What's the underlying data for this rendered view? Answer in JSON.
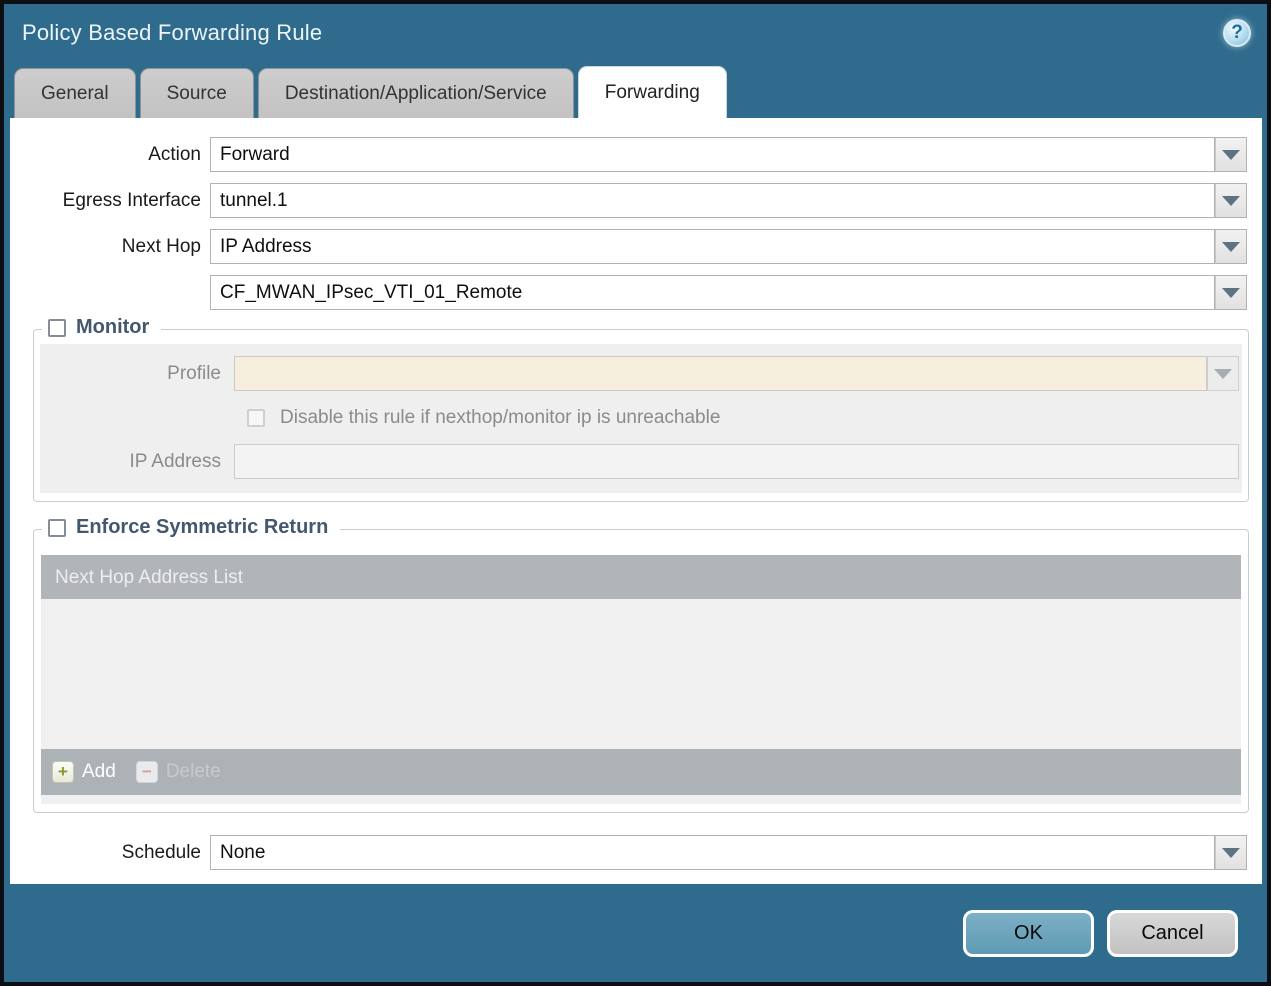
{
  "window": {
    "title": "Policy Based Forwarding Rule"
  },
  "icons": {
    "help": "?",
    "add": "+",
    "delete": "−"
  },
  "tabs": [
    {
      "label": "General",
      "active": false
    },
    {
      "label": "Source",
      "active": false
    },
    {
      "label": "Destination/Application/Service",
      "active": false
    },
    {
      "label": "Forwarding",
      "active": true
    }
  ],
  "form": {
    "action": {
      "label": "Action",
      "value": "Forward"
    },
    "egress_interface": {
      "label": "Egress Interface",
      "value": "tunnel.1"
    },
    "next_hop": {
      "label": "Next Hop",
      "value": "IP Address"
    },
    "next_hop_address": {
      "value": "CF_MWAN_IPsec_VTI_01_Remote"
    },
    "schedule": {
      "label": "Schedule",
      "value": "None"
    }
  },
  "monitor": {
    "legend": "Monitor",
    "checked": false,
    "profile": {
      "label": "Profile",
      "value": ""
    },
    "disable_rule": {
      "label": "Disable this rule if nexthop/monitor ip is unreachable",
      "checked": false
    },
    "ip_address": {
      "label": "IP Address",
      "value": ""
    }
  },
  "enforce": {
    "legend": "Enforce Symmetric Return",
    "checked": false,
    "table": {
      "header": "Next Hop Address List",
      "rows": []
    },
    "add_label": "Add",
    "delete_label": "Delete"
  },
  "footer": {
    "ok_label": "OK",
    "cancel_label": "Cancel"
  },
  "colors": {
    "titlebar": "#2e6b8d",
    "outer_border": "#0b0f14",
    "tab_inactive": "#c6c6c6",
    "tab_active": "#ffffff",
    "legend_text": "#44586d",
    "profile_field_bg": "#f6efdd",
    "disabled_panel_bg": "#efefef",
    "table_header_bg": "#b1b5b9",
    "table_body_bg": "#f0f0f0",
    "table_footer_bg": "#adb2b7",
    "ok_button": "#6ba3bb",
    "cancel_button": "#c9c9c9",
    "add_plus": "#88982c",
    "delete_minus": "#d59aa2"
  }
}
